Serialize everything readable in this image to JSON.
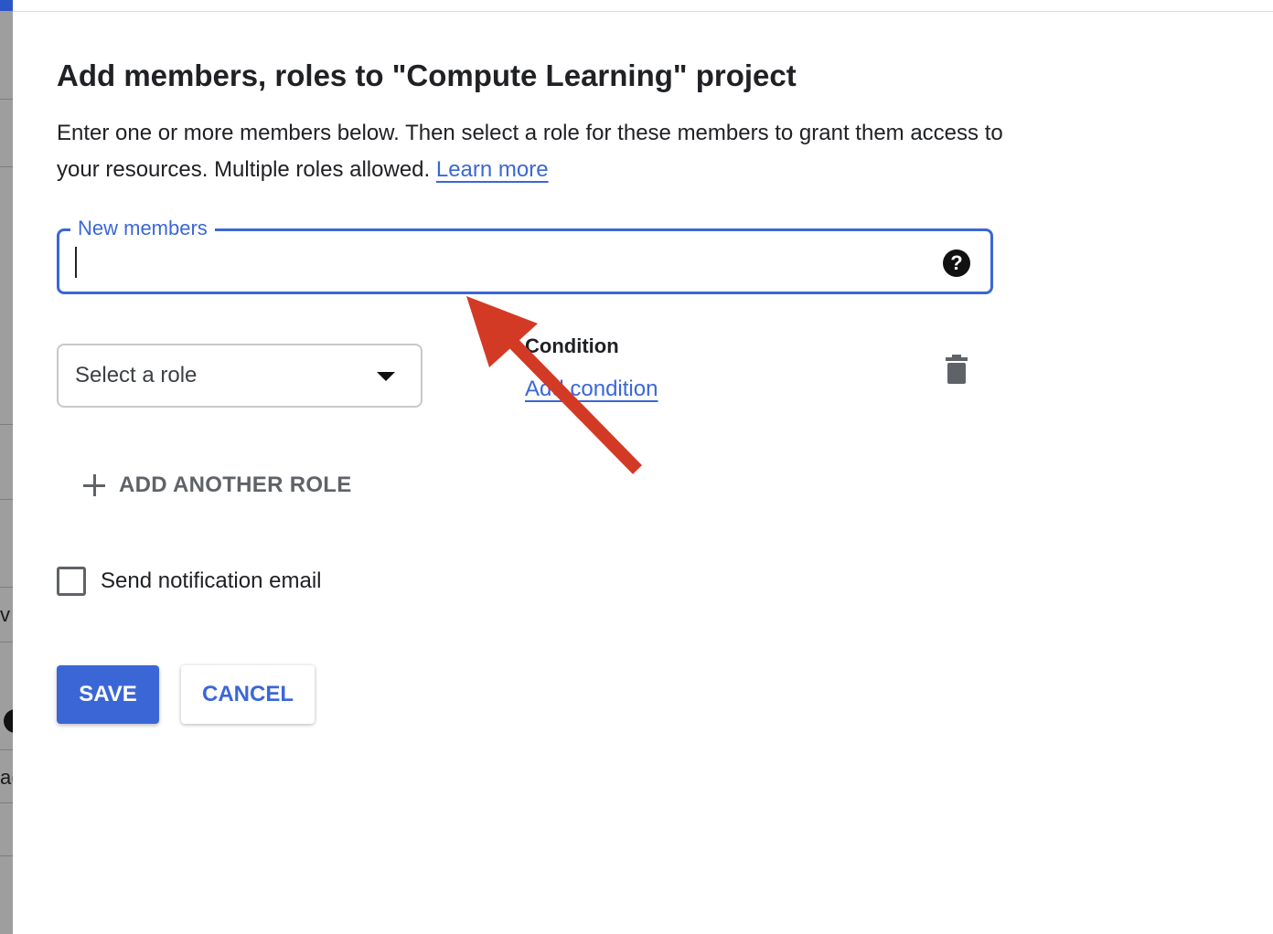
{
  "dialog": {
    "title": "Add members, roles to \"Compute Learning\" project",
    "description": "Enter one or more members below. Then select a role for these members to grant them access to your resources. Multiple roles allowed.",
    "learn_more": "Learn more"
  },
  "members_field": {
    "label": "New members",
    "value": "",
    "help_icon": "help-circle-icon"
  },
  "role": {
    "select_label": "Select a role",
    "dropdown_icon": "arrow-drop-down-icon",
    "condition_heading": "Condition",
    "add_condition": "Add condition",
    "delete_icon": "trash-icon"
  },
  "add_role": {
    "icon": "plus-icon",
    "label": "ADD ANOTHER ROLE"
  },
  "notification": {
    "label": "Send notification email",
    "checked": false
  },
  "actions": {
    "save": "SAVE",
    "cancel": "CANCEL"
  },
  "background": {
    "fragment_1": "v",
    "fragment_2": "a("
  },
  "annotation": {
    "type": "arrow",
    "color": "#d33a25"
  },
  "colors": {
    "accent": "#3b67d6",
    "text": "#202124",
    "muted": "#5f6368"
  }
}
